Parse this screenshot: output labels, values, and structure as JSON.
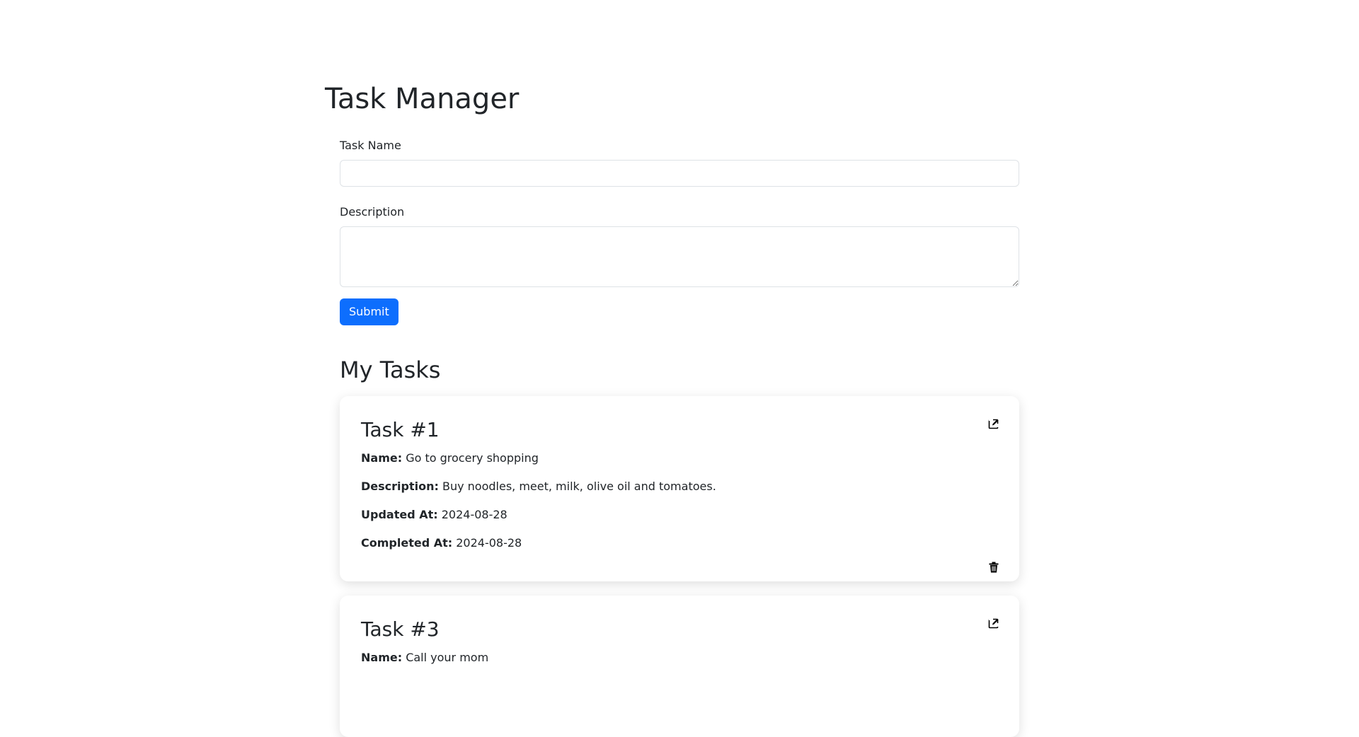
{
  "page": {
    "title": "Task Manager"
  },
  "form": {
    "task_name_label": "Task Name",
    "task_name_value": "",
    "description_label": "Description",
    "description_value": "",
    "submit_label": "Submit"
  },
  "tasks_section": {
    "heading": "My Tasks"
  },
  "tasks": [
    {
      "title": "Task #1",
      "name_label": "Name:",
      "name": "Go to grocery shopping",
      "description_label": "Description:",
      "description": "Buy noodles, meet, milk, olive oil and tomatoes.",
      "updated_label": "Updated At:",
      "updated_at": "2024-08-28",
      "completed_label": "Completed At:",
      "completed_at": "2024-08-28"
    },
    {
      "title": "Task #3",
      "name_label": "Name:",
      "name": "Call your mom"
    }
  ],
  "icons": {
    "edit": "edit-icon",
    "delete": "trash-icon"
  },
  "colors": {
    "primary": "#0d6efd",
    "text": "#212529",
    "border": "#dee2e6"
  }
}
